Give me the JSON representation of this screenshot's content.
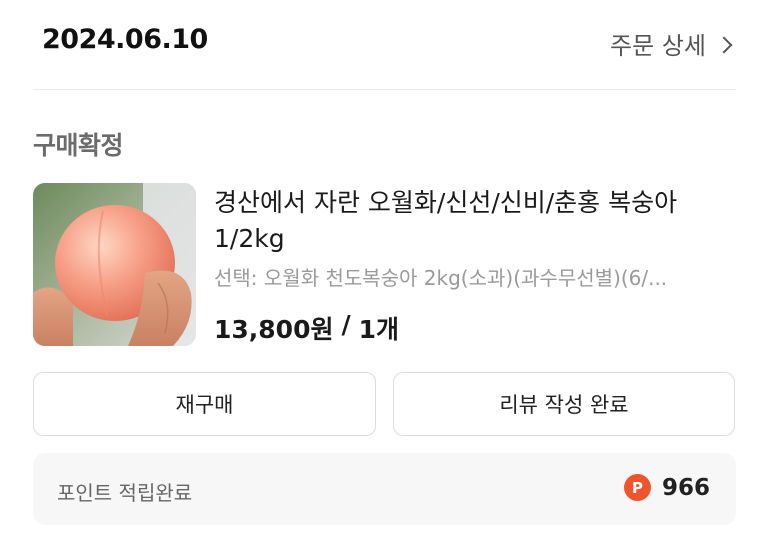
{
  "order": {
    "date": "2024.06.10",
    "detail_link": "주문 상세",
    "status": "구매확정"
  },
  "product": {
    "name": "경산에서 자란 오월화/신선/신비/춘홍 복숭아 1/2kg",
    "option": "선택: 오월화 천도복숭아 2kg(소과)(과수무선별)(6/...",
    "price": "13,800원",
    "separator": "/",
    "quantity": "1개",
    "image_icon": "peach-photo"
  },
  "actions": {
    "rebuy_label": "재구매",
    "review_label": "리뷰 작성 완료"
  },
  "points": {
    "label": "포인트 적립완료",
    "icon_letter": "P",
    "value": "966",
    "accent_color": "#f0542a"
  }
}
